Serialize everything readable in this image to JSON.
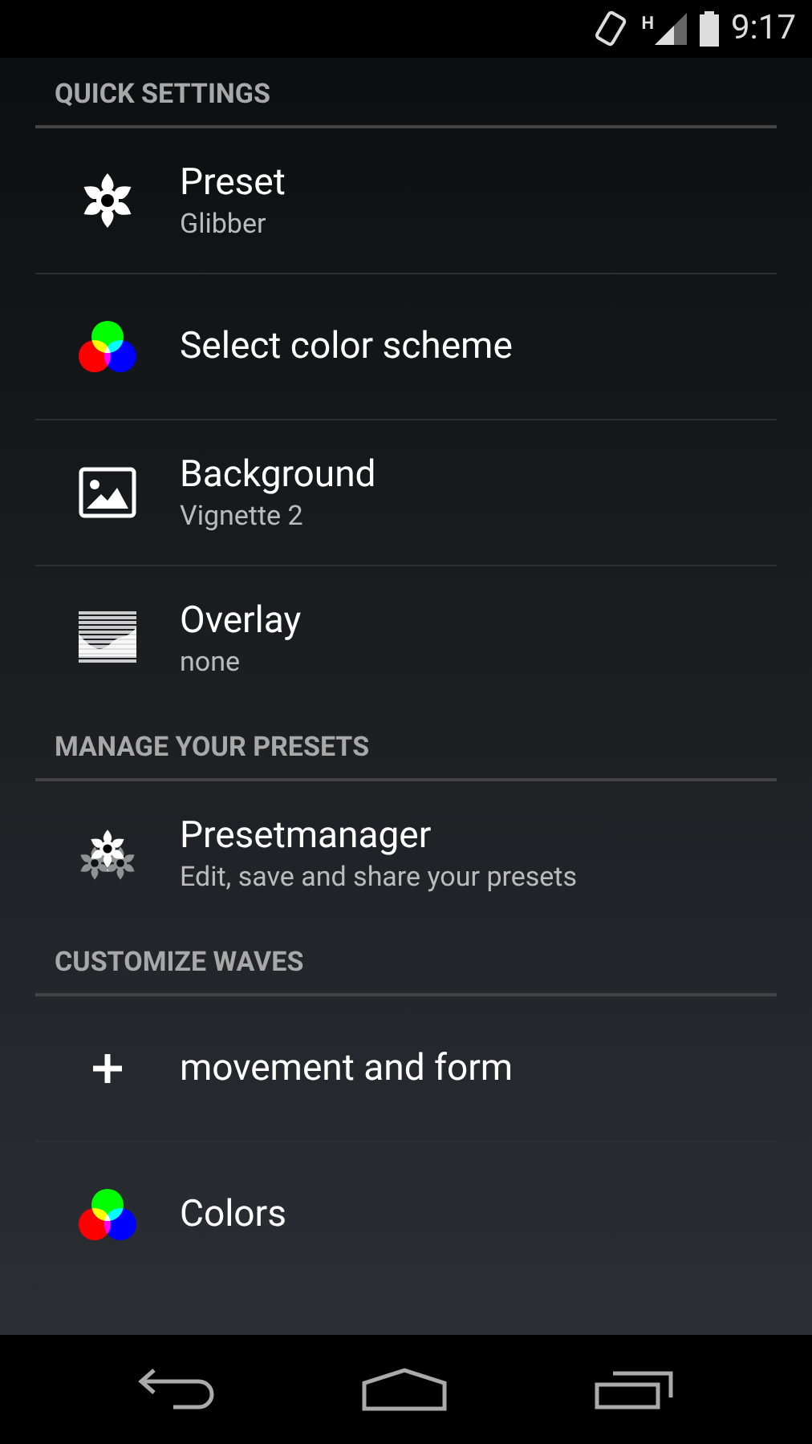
{
  "status_bar": {
    "network": "H",
    "time": "9:17"
  },
  "sections": [
    {
      "title": "QUICK SETTINGS",
      "items": [
        {
          "kind": "flower",
          "title": "Preset",
          "subtitle": "Glibber"
        },
        {
          "kind": "rgb",
          "title": "Select color scheme"
        },
        {
          "kind": "image",
          "title": "Background",
          "subtitle": "Vignette 2"
        },
        {
          "kind": "overlay",
          "title": "Overlay",
          "subtitle": "none"
        }
      ]
    },
    {
      "title": "MANAGE YOUR PRESETS",
      "items": [
        {
          "kind": "flowers",
          "title": "Presetmanager",
          "subtitle": "Edit, save and share your presets"
        }
      ]
    },
    {
      "title": "CUSTOMIZE WAVES",
      "items": [
        {
          "kind": "plus",
          "title": "movement and form"
        },
        {
          "kind": "rgb",
          "title": "Colors"
        }
      ]
    }
  ]
}
